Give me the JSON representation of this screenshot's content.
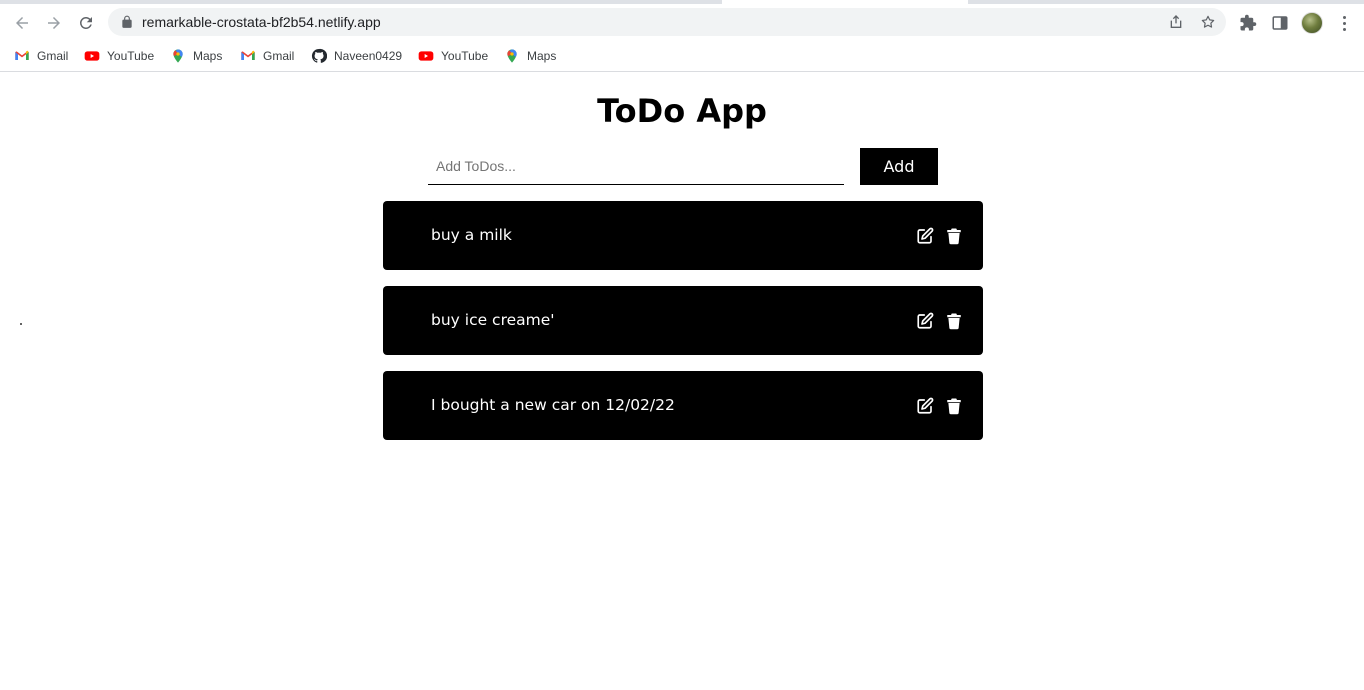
{
  "browser": {
    "url": "remarkable-crostata-bf2b54.netlify.app",
    "icons": [
      "back-icon",
      "forward-icon",
      "reload-icon",
      "lock-icon",
      "share-icon",
      "star-icon",
      "extensions-icon",
      "side-panel-icon",
      "profile-avatar",
      "menu-icon"
    ]
  },
  "bookmarks": [
    {
      "label": "Gmail",
      "icon": "gmail-icon"
    },
    {
      "label": "YouTube",
      "icon": "youtube-icon"
    },
    {
      "label": "Maps",
      "icon": "maps-icon"
    },
    {
      "label": "Gmail",
      "icon": "gmail-icon"
    },
    {
      "label": "Naveen0429",
      "icon": "github-icon"
    },
    {
      "label": "YouTube",
      "icon": "youtube-icon"
    },
    {
      "label": "Maps",
      "icon": "maps-icon"
    }
  ],
  "app": {
    "title": "ToDo App",
    "input": {
      "placeholder": "Add ToDos...",
      "value": ""
    },
    "add_label": "Add",
    "todos": [
      {
        "text": "buy a milk"
      },
      {
        "text": "buy ice creame'"
      },
      {
        "text": "I bought a new car on 12/02/22"
      }
    ]
  },
  "colors": {
    "accent": "#000000",
    "item_text": "#ffffff",
    "background": "#ffffff"
  }
}
